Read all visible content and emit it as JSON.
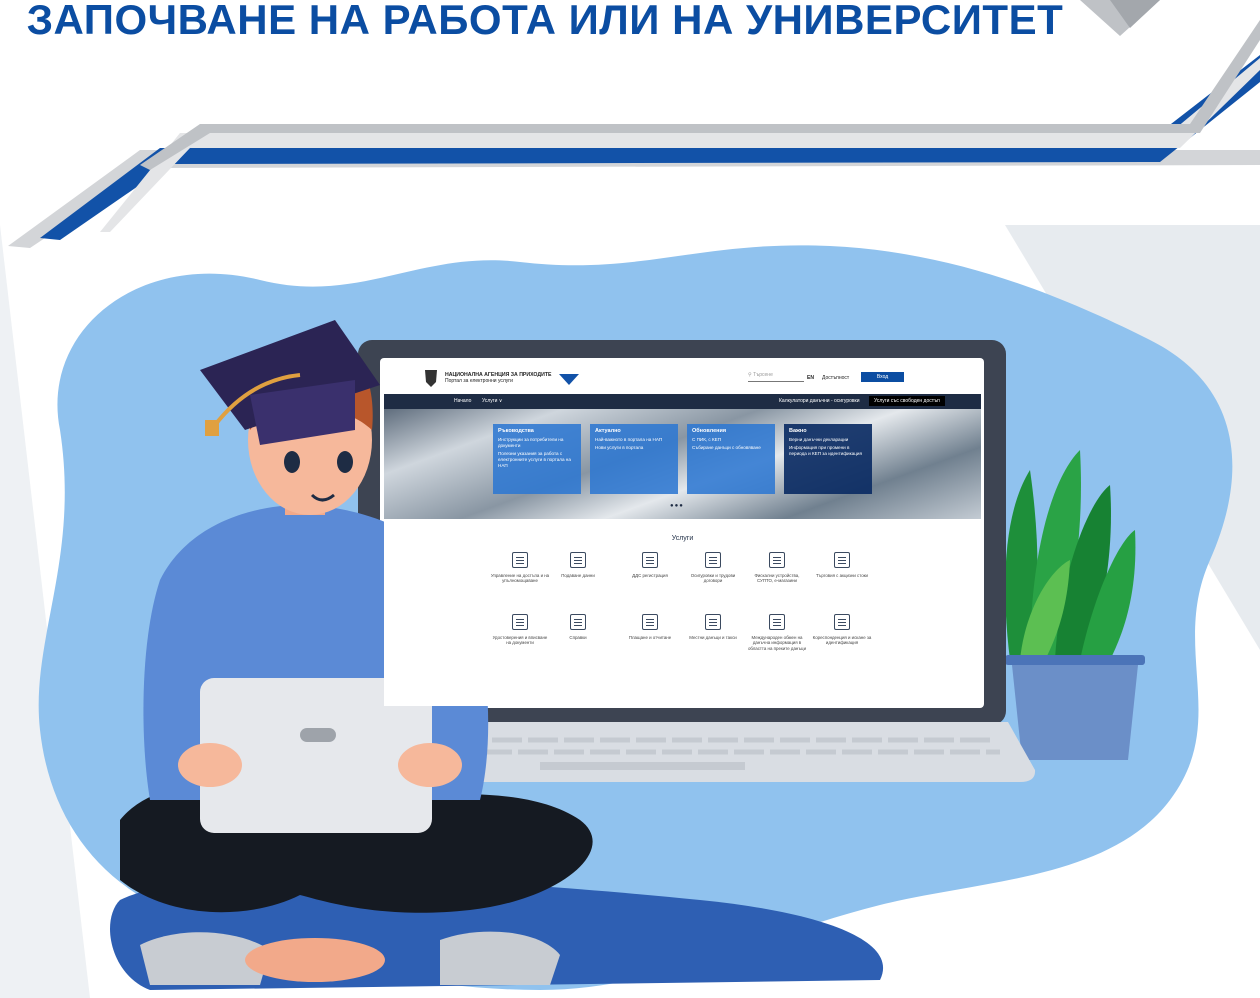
{
  "headline": "ЗАПОЧВАНЕ НА РАБОТА ИЛИ НА УНИВЕРСИТЕТ",
  "colors": {
    "headline_blue": "#0b4da2",
    "background_blob": "#90c2ee",
    "site_nav": "#1e2c44"
  },
  "site": {
    "agency_name": "НАЦИОНАЛНА АГЕНЦИЯ ЗА ПРИХОДИТЕ",
    "agency_subtitle": "Портал за електронни услуги",
    "search_placeholder": "Търсене",
    "lang": "EN",
    "accessibility": "Достъпност",
    "login": "Вход",
    "nav": {
      "home": "Начало",
      "services": "Услуги ∨",
      "calculator": "Калкулатори данъчни - осигуровки",
      "services_without_login": "Услуги със свободен достъп"
    },
    "cards": [
      {
        "title": "Ръководства",
        "lines": [
          "Инструкции за потребители на документи",
          "Полезни указания за работа с електронните услуги в портала на НАП"
        ]
      },
      {
        "title": "Актуално",
        "lines": [
          "Най-важното в портала на НАП",
          "Нови услуги в портала"
        ]
      },
      {
        "title": "Обновления",
        "lines": [
          "С ПИК, с КЕП",
          "Събиране данъци с обновяване"
        ]
      },
      {
        "title": "Важно",
        "lines": [
          "Верни данъчни декларации",
          "Информация при промени в периода и КЕП за идентификация"
        ]
      }
    ],
    "services_title": "Услуги",
    "services": [
      {
        "icon": "document-icon",
        "label": "Управление на достъпа и на упълномощаване"
      },
      {
        "icon": "edit-document-icon",
        "label": "Подаване данни"
      },
      {
        "icon": "percent-icon",
        "label": "ДДС регистрация"
      },
      {
        "icon": "person-badge-icon",
        "label": "Осигуровки и трудови договори"
      },
      {
        "icon": "cash-register-icon",
        "label": "Фискални устройства, СУПТО, е-магазини"
      },
      {
        "icon": "folder-fire-icon",
        "label": "Търговия с акцизни стоки"
      },
      {
        "icon": "clipboard-icon",
        "label": "Удостоверения и вписване на документи"
      },
      {
        "icon": "magnifier-document-icon",
        "label": "Справки"
      },
      {
        "icon": "payment-card-icon",
        "label": "Плащане и отчитане"
      },
      {
        "icon": "car-house-icon",
        "label": "Местни данъци и такси"
      },
      {
        "icon": "globe-icon",
        "label": "Международен обмен на данъчна информация в областта на преките данъци"
      },
      {
        "icon": "document-check-icon",
        "label": "Кореспонденция и искане за идентификация"
      }
    ]
  }
}
